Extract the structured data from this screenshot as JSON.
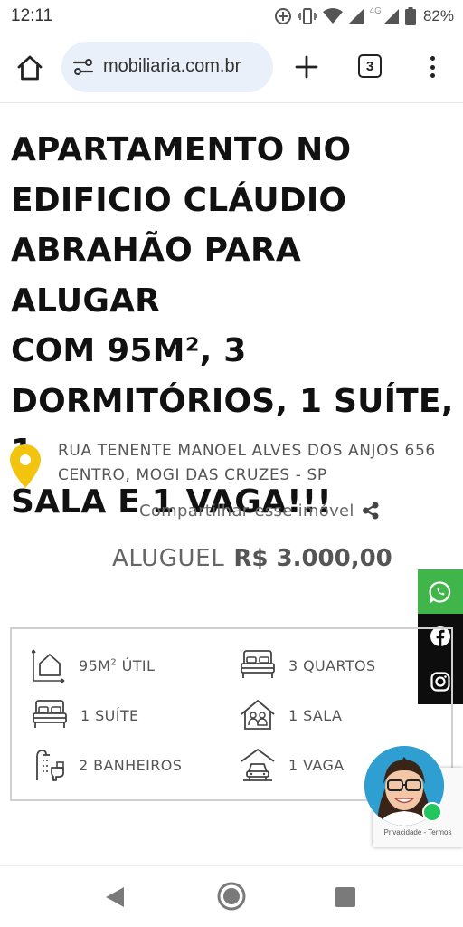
{
  "status_bar": {
    "time": "12:11",
    "network": "4G",
    "battery": "82%"
  },
  "browser": {
    "url": "mobiliaria.com.br",
    "tab_count": "3",
    "icons": [
      "home-icon",
      "site-settings-icon",
      "new-tab-icon",
      "tab-switcher-icon",
      "more-menu-icon"
    ]
  },
  "listing": {
    "title_lines": [
      "APARTAMENTO NO",
      "EDIFICIO CLÁUDIO",
      "ABRAHÃO PARA ALUGAR",
      "COM 95M², 3",
      "DORMITÓRIOS, 1 SUÍTE, 1",
      "SALA E 1 VAGA!!!"
    ],
    "address_line1": "RUA TENENTE MANOEL ALVES DOS ANJOS 656",
    "address_line2": "CENTRO, MOGI DAS CRUZES - SP",
    "share_label": "Compartilhar esse imóvel",
    "price_label": "ALUGUEL",
    "price_value": "R$ 3.000,00"
  },
  "features": {
    "area_value": "95M",
    "area_sup": "2",
    "area_suffix": " ÚTIL",
    "bedrooms": "3 QUARTOS",
    "suites": "1 SUÍTE",
    "living_rooms": "1 SALA",
    "bathrooms": "2 BANHEIROS",
    "parking": "1 VAGA"
  },
  "social": {
    "icons": [
      "whatsapp-icon",
      "facebook-icon",
      "instagram-icon"
    ],
    "whatsapp_color": "#3fb54a",
    "dark_color": "#0d0d0d"
  },
  "recaptcha": {
    "text": "Privacidade - Termos"
  },
  "colors": {
    "pin": "#f2c40f",
    "url_pill": "#eaf0f9",
    "chat_bg": "#2f9fd1",
    "online": "#22c55e"
  }
}
